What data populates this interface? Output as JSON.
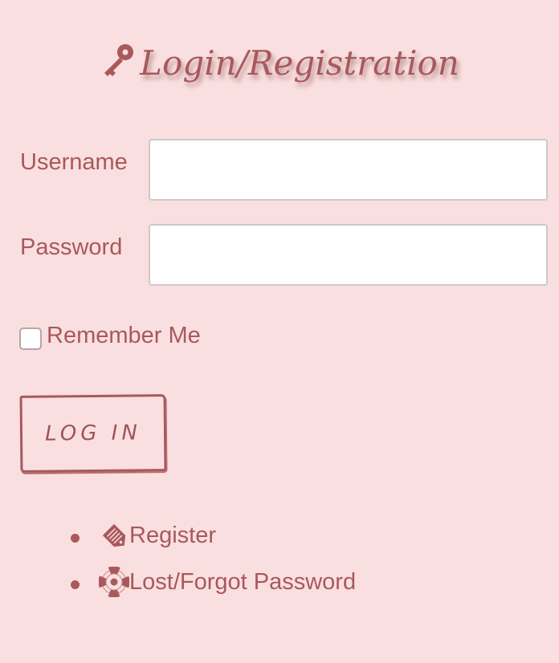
{
  "page": {
    "title": "Login/Registration",
    "title_icon": "key-icon"
  },
  "form": {
    "username_label": "Username",
    "username_value": "",
    "username_placeholder": "",
    "password_label": "Password",
    "password_value": "",
    "password_placeholder": "",
    "remember_label": "Remember Me",
    "remember_checked": false,
    "login_label": "LOG IN"
  },
  "links": [
    {
      "label": "Register",
      "icon": "tag-icon"
    },
    {
      "label": "Lost/Forgot Password",
      "icon": "lifebuoy-icon"
    }
  ],
  "colors": {
    "background": "#fadfe0",
    "accent": "#a8595c",
    "input_border": "#cfc8c8"
  }
}
